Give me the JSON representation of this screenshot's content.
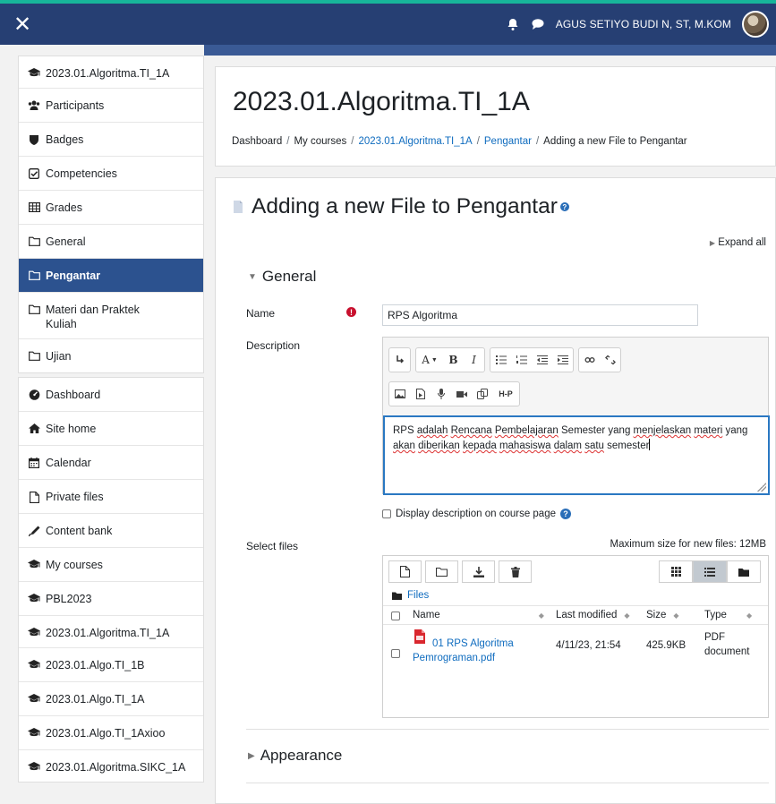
{
  "topbar": {
    "close_label": "✕",
    "user_name": "AGUS SETIYO BUDI N, ST, M.KOM"
  },
  "sidebar": {
    "groups": [
      [
        {
          "icon": "graduation-cap-icon",
          "label": "2023.01.Algoritma.TI_1A"
        },
        {
          "icon": "users-icon",
          "label": "Participants"
        },
        {
          "icon": "shield-icon",
          "label": "Badges"
        },
        {
          "icon": "check-square-icon",
          "label": "Competencies"
        },
        {
          "icon": "table-icon",
          "label": "Grades"
        },
        {
          "icon": "folder-icon",
          "label": "General"
        },
        {
          "icon": "folder-icon",
          "label": "Pengantar",
          "active": true
        },
        {
          "icon": "folder-icon",
          "label": "Materi dan Praktek Kuliah"
        },
        {
          "icon": "folder-icon",
          "label": "Ujian"
        }
      ],
      [
        {
          "icon": "dashboard-icon",
          "label": "Dashboard"
        },
        {
          "icon": "home-icon",
          "label": "Site home"
        },
        {
          "icon": "calendar-icon",
          "label": "Calendar"
        },
        {
          "icon": "file-icon",
          "label": "Private files"
        },
        {
          "icon": "pen-icon",
          "label": "Content bank"
        },
        {
          "icon": "graduation-cap-icon",
          "label": "My courses"
        },
        {
          "icon": "graduation-cap-icon",
          "label": "PBL2023"
        },
        {
          "icon": "graduation-cap-icon",
          "label": "2023.01.Algoritma.TI_1A"
        },
        {
          "icon": "graduation-cap-icon",
          "label": "2023.01.Algo.TI_1B"
        },
        {
          "icon": "graduation-cap-icon",
          "label": "2023.01.Algo.TI_1A"
        },
        {
          "icon": "graduation-cap-icon",
          "label": "2023.01.Algo.TI_1Axioo"
        },
        {
          "icon": "graduation-cap-icon",
          "label": "2023.01.Algoritma.SIKC_1A"
        }
      ]
    ]
  },
  "header": {
    "title": "2023.01.Algoritma.TI_1A",
    "breadcrumb": [
      {
        "label": "Dashboard",
        "link": false
      },
      {
        "label": "My courses",
        "link": false
      },
      {
        "label": "2023.01.Algoritma.TI_1A",
        "link": true
      },
      {
        "label": "Pengantar",
        "link": true
      },
      {
        "label": "Adding a new File to Pengantar",
        "link": false
      }
    ],
    "separator": "/"
  },
  "form": {
    "title": "Adding a new File to Pengantar",
    "expand_all": "Expand all",
    "general_section": "General",
    "name_label": "Name",
    "name_value": "RPS Algoritma",
    "description_label": "Description",
    "description_parts": [
      {
        "t": "RPS ",
        "err": false
      },
      {
        "t": "adalah",
        "err": true
      },
      {
        "t": " ",
        "err": false
      },
      {
        "t": "Rencana",
        "err": true
      },
      {
        "t": " ",
        "err": false
      },
      {
        "t": "Pembelajaran",
        "err": true
      },
      {
        "t": " Semester yang ",
        "err": false
      },
      {
        "t": "menjelaskan",
        "err": true
      },
      {
        "t": " ",
        "err": false
      },
      {
        "t": "materi",
        "err": true
      },
      {
        "t": " yang ",
        "err": false
      },
      {
        "t": "akan",
        "err": true
      },
      {
        "t": " ",
        "err": false
      },
      {
        "t": "diberikan",
        "err": true
      },
      {
        "t": " ",
        "err": false
      },
      {
        "t": "kepada",
        "err": true
      },
      {
        "t": " ",
        "err": false
      },
      {
        "t": "mahasiswa",
        "err": true
      },
      {
        "t": " ",
        "err": false
      },
      {
        "t": "dalam",
        "err": true
      },
      {
        "t": " ",
        "err": false
      },
      {
        "t": "satu",
        "err": true
      },
      {
        "t": " semester",
        "err": false
      }
    ],
    "display_description_label": "Display description on course page",
    "select_files_label": "Select files",
    "max_size": "Maximum size for new files: 12MB",
    "appearance_section": "Appearance"
  },
  "editor_toolbar": {
    "font_label": "A",
    "bold": "B",
    "italic": "I",
    "h5p": "H-P"
  },
  "filepicker": {
    "path_label": "Files",
    "columns": {
      "name": "Name",
      "modified": "Last modified",
      "size": "Size",
      "type": "Type"
    },
    "files": [
      {
        "name_line1": "01 RPS Algoritma",
        "name_line2": "Pemrograman.pdf",
        "modified": "4/11/23, 21:54",
        "size": "425.9KB",
        "type_line1": "PDF",
        "type_line2": "document"
      }
    ]
  },
  "colors": {
    "navbar": "#263f73",
    "accent_strip": "#17b59a",
    "active_nav": "#2c528f",
    "link": "#0f6cbf",
    "required": "#c8102e"
  }
}
